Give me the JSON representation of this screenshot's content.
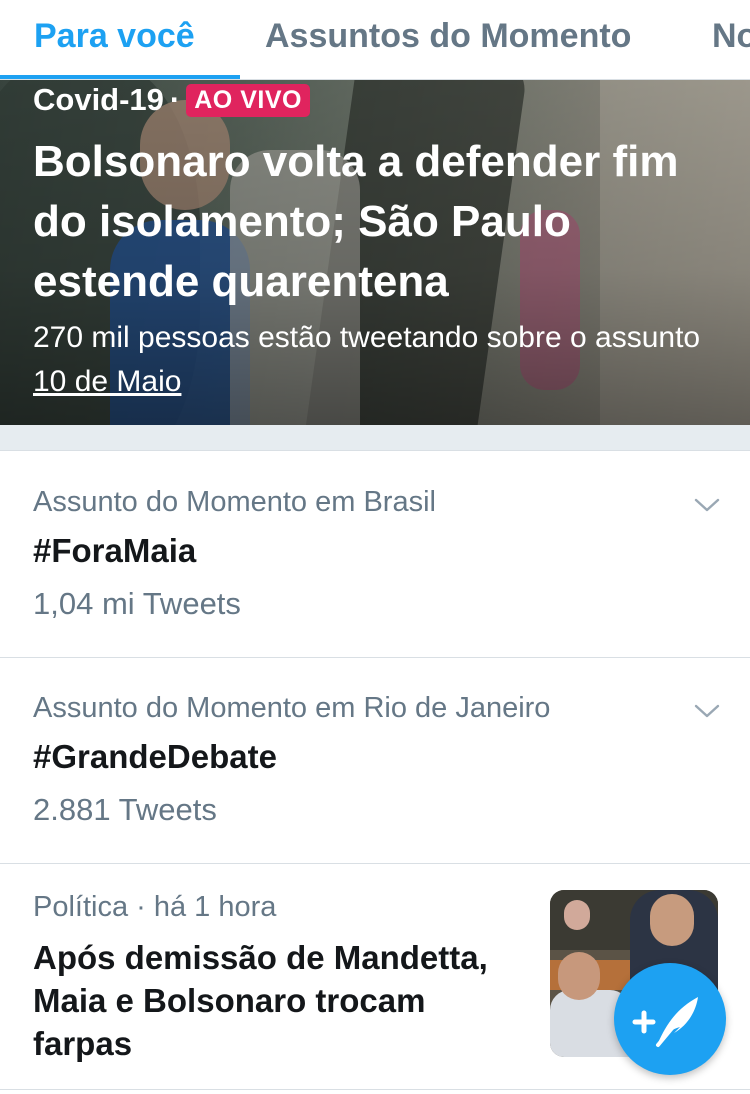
{
  "tabs": [
    {
      "label": "Para você",
      "active": true
    },
    {
      "label": "Assuntos do Momento",
      "active": false
    },
    {
      "label": "No",
      "active": false
    }
  ],
  "hero": {
    "category": "Covid-19",
    "separator": "·",
    "live_badge": "AO VIVO",
    "title": "Bolsonaro volta a defender fim do isolamento; São Paulo estende quarentena",
    "subtitle": "270 mil pessoas estão tweetando sobre o assunto",
    "date_link": "10 de Maio"
  },
  "trends": [
    {
      "context": "Assunto do Momento em Brasil",
      "name": "#ForaMaia",
      "count": "1,04 mi Tweets"
    },
    {
      "context": "Assunto do Momento em Rio de Janeiro",
      "name": "#GrandeDebate",
      "count": "2.881 Tweets"
    }
  ],
  "news": {
    "meta": "Política · há 1 hora",
    "title": "Após demissão de Mandetta, Maia e Bolsonaro trocam farpas"
  },
  "icons": {
    "chevron": "chevron-down-icon",
    "compose": "compose-tweet-icon"
  },
  "colors": {
    "accent": "#1da1f2",
    "live": "#e0245e",
    "secondary_text": "#657786",
    "primary_text": "#14171a",
    "separator": "#e6ecf0"
  }
}
